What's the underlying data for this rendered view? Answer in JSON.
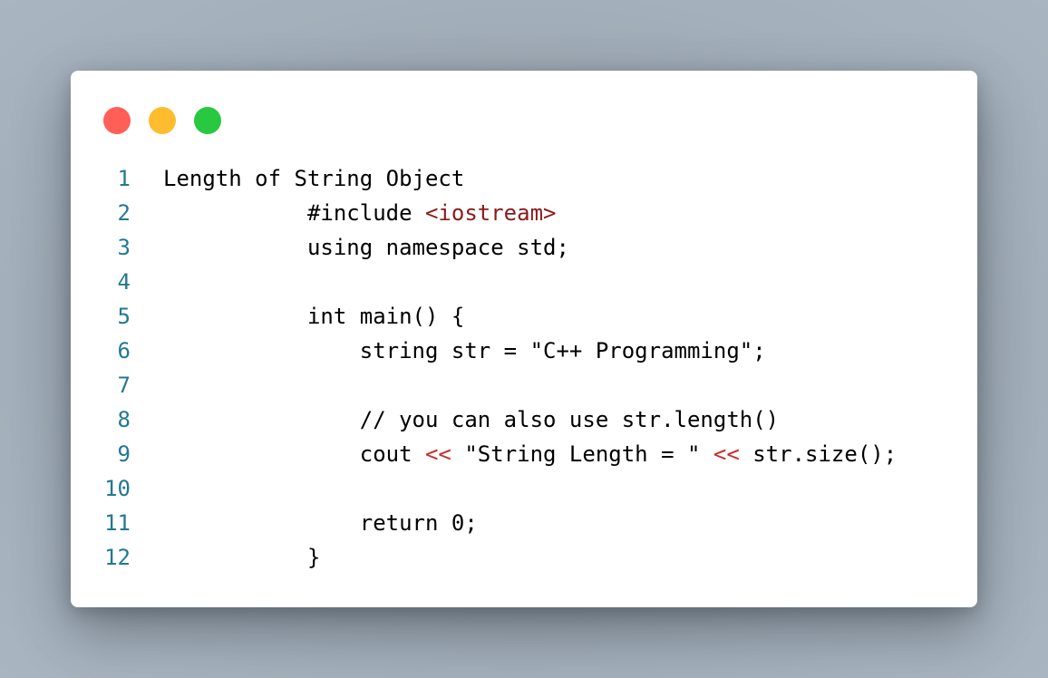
{
  "window": {
    "traffic_lights": {
      "close_color": "#ff5f57",
      "minimize_color": "#febc2e",
      "maximize_color": "#28c840"
    }
  },
  "code": {
    "line_number_color": "#237893",
    "lines": [
      {
        "n": "1",
        "text": "Length of String Object"
      },
      {
        "n": "2",
        "pre": "           #include ",
        "inc": "<iostream>"
      },
      {
        "n": "3",
        "text": "           using namespace std;"
      },
      {
        "n": "4",
        "text": ""
      },
      {
        "n": "5",
        "text": "           int main() {"
      },
      {
        "n": "6",
        "text": "               string str = \"C++ Programming\";"
      },
      {
        "n": "7",
        "text": ""
      },
      {
        "n": "8",
        "text": "               // you can also use str.length()"
      },
      {
        "n": "9",
        "a": "               cout ",
        "op1": "<<",
        "b": " \"String Length = \" ",
        "op2": "<<",
        "c": " str.size();"
      },
      {
        "n": "10",
        "text": ""
      },
      {
        "n": "11",
        "text": "               return 0;"
      },
      {
        "n": "12",
        "text": "           }"
      }
    ]
  }
}
